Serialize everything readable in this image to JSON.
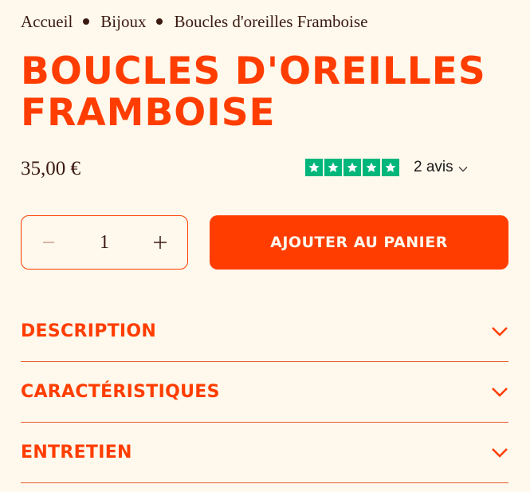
{
  "breadcrumb": {
    "items": [
      "Accueil",
      "Bijoux"
    ],
    "current": "Boucles d'oreilles Framboise"
  },
  "product": {
    "title": "BOUCLES D'OREILLES FRAMBOISE",
    "price": "35,00 €",
    "rating": {
      "stars": 5,
      "reviews_label": "2 avis",
      "star_color": "#00b67a"
    }
  },
  "quantity": {
    "value": "1",
    "decrement_icon": "minus-icon",
    "increment_icon": "plus-icon"
  },
  "cart": {
    "add_label": "AJOUTER AU PANIER"
  },
  "accordion": [
    {
      "label": "DESCRIPTION"
    },
    {
      "label": "CARACTÉRISTIQUES"
    },
    {
      "label": "ENTRETIEN"
    }
  ],
  "colors": {
    "accent": "#ff3d00",
    "background": "#fff8ec",
    "text": "#3b1a12"
  }
}
